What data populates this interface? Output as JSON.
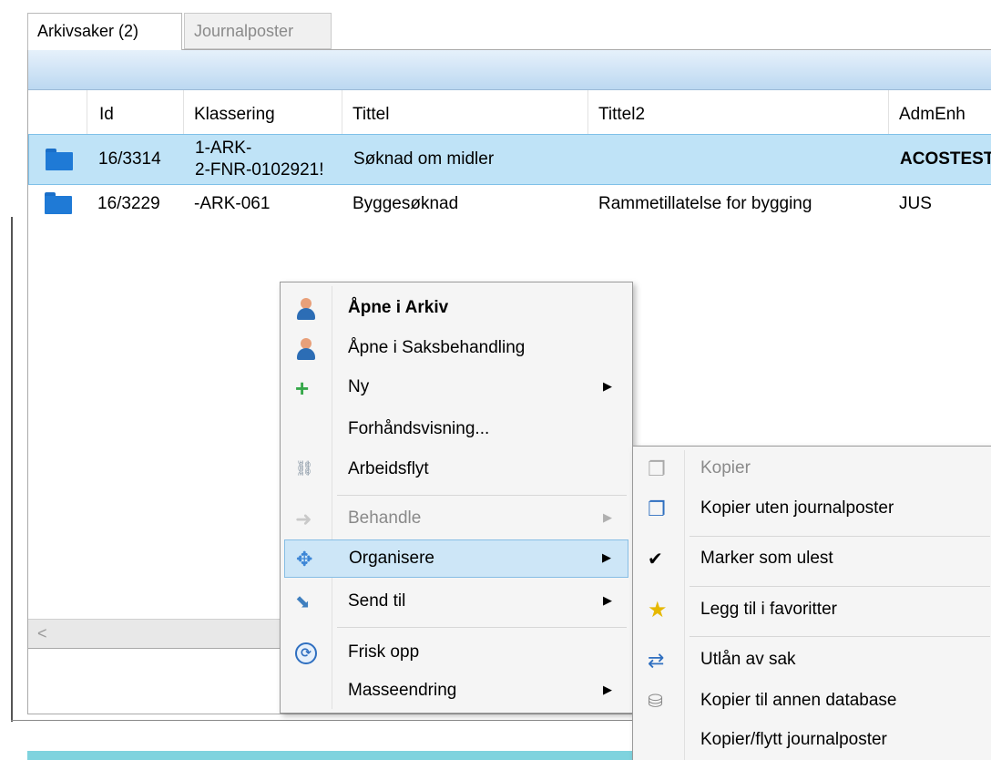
{
  "tabs": [
    {
      "label": "Arkivsaker (2)"
    },
    {
      "label": "Journalposter"
    }
  ],
  "columns": [
    "Id",
    "Klassering",
    "Tittel",
    "Tittel2",
    "AdmEnh"
  ],
  "rows": [
    {
      "id": "16/3314",
      "klassering_line1": "1-ARK-",
      "klassering_line2": "2-FNR-0102921!",
      "tittel": "Søknad om midler",
      "tittel2": "",
      "admenh": "ACOSTEST",
      "selected": true
    },
    {
      "id": "16/3229",
      "klassering_line1": "-ARK-061",
      "klassering_line2": "",
      "tittel": "Byggesøknad",
      "tittel2": "Rammetillatelse for bygging",
      "admenh": "JUS",
      "selected": false
    }
  ],
  "scroll_left_glyph": "<",
  "context_menu": {
    "items": [
      {
        "label": "Åpne i Arkiv",
        "icon": "person-icon"
      },
      {
        "label": "Åpne i Saksbehandling",
        "icon": "person-icon"
      },
      {
        "label": "Ny",
        "icon": "plus-icon",
        "submenu_arrow": "▶"
      },
      {
        "label": "Forhåndsvisning...",
        "icon": ""
      },
      {
        "label": "Arbeidsflyt",
        "icon": "workflow-icon"
      },
      {
        "label": "Behandle",
        "icon": "arrow-icon",
        "submenu_arrow": "▶",
        "disabled": true
      },
      {
        "label": "Organisere",
        "icon": "move-icon",
        "submenu_arrow": "▶",
        "highlighted": true
      },
      {
        "label": "Send til",
        "icon": "send-icon",
        "submenu_arrow": "▶"
      },
      {
        "label": "Frisk opp",
        "icon": "refresh-icon"
      },
      {
        "label": "Masseendring",
        "icon": "",
        "submenu_arrow": "▶"
      }
    ]
  },
  "submenu": {
    "items": [
      {
        "label": "Kopier",
        "icon": "copy-icon",
        "disabled": true
      },
      {
        "label": "Kopier uten journalposter",
        "icon": "copy-without-icon"
      },
      {
        "label": "Marker som ulest",
        "icon": "check-icon"
      },
      {
        "label": "Legg til i favoritter",
        "icon": "star-icon"
      },
      {
        "label": "Utlån av sak",
        "icon": "swap-icon"
      },
      {
        "label": "Kopier til annen database",
        "icon": "database-icon"
      },
      {
        "label": "Kopier/flytt journalposter",
        "icon": ""
      }
    ]
  },
  "icons": {
    "person": "👤",
    "plus": "+",
    "workflow": "⛓",
    "arrow": "➜",
    "move": "✥",
    "send": "⬊",
    "refresh": "⟳",
    "copy": "❐",
    "copy_without": "❐",
    "check": "✔",
    "star": "★",
    "swap": "⇄",
    "database": "⛁"
  },
  "colors": {
    "selection": "#bfe3f7",
    "menu_highlight": "#cde6f7",
    "folder": "#1f7ad6",
    "accent_bar": "#7fd3de"
  }
}
